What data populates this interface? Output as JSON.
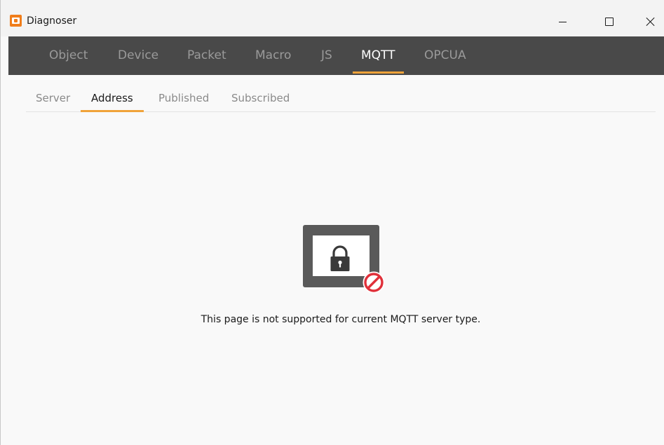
{
  "window": {
    "title": "Diagnoser",
    "accent_color": "#f0a33a",
    "nav_background": "#494949"
  },
  "topnav": {
    "tabs": [
      {
        "label": "Object",
        "active": false
      },
      {
        "label": "Device",
        "active": false
      },
      {
        "label": "Packet",
        "active": false
      },
      {
        "label": "Macro",
        "active": false
      },
      {
        "label": "JS",
        "active": false
      },
      {
        "label": "MQTT",
        "active": true
      },
      {
        "label": "OPCUA",
        "active": false
      }
    ]
  },
  "subnav": {
    "tabs": [
      {
        "label": "Server",
        "active": false
      },
      {
        "label": "Address",
        "active": true
      },
      {
        "label": "Published",
        "active": false
      },
      {
        "label": "Subscribed",
        "active": false
      }
    ]
  },
  "main": {
    "illustration_icon": "locked-monitor-icon",
    "badge_icon": "prohibited-icon",
    "message": "This page is not supported for current MQTT server type."
  }
}
